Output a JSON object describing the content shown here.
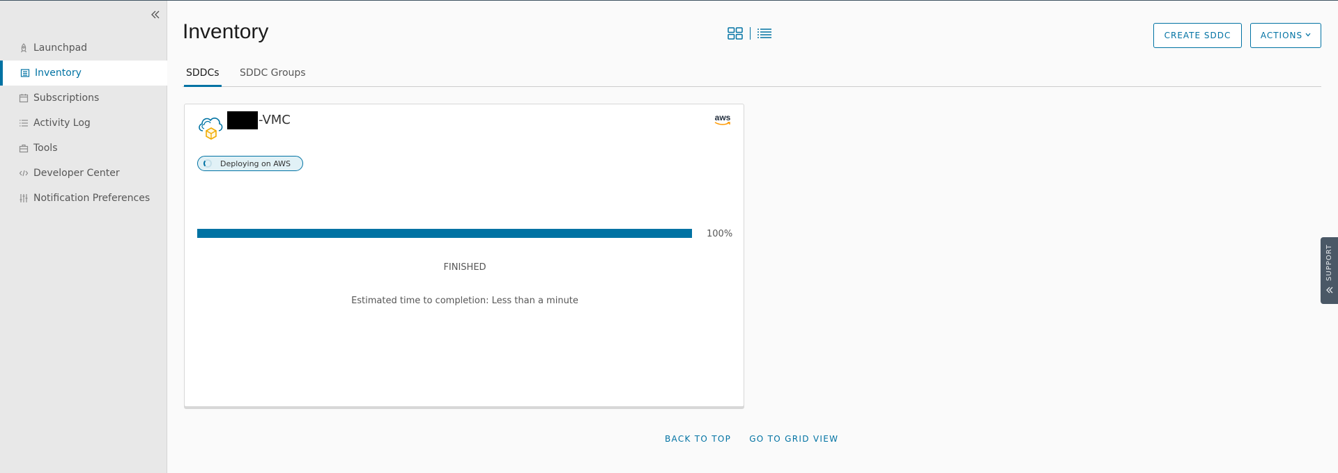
{
  "sidebar": {
    "collapse_icon": "double-chevron-left-icon",
    "items": [
      {
        "label": "Launchpad",
        "icon": "rocket-icon",
        "active": false
      },
      {
        "label": "Inventory",
        "icon": "inventory-icon",
        "active": true
      },
      {
        "label": "Subscriptions",
        "icon": "calendar-icon",
        "active": false
      },
      {
        "label": "Activity Log",
        "icon": "list-icon",
        "active": false
      },
      {
        "label": "Tools",
        "icon": "toolbox-icon",
        "active": false
      },
      {
        "label": "Developer Center",
        "icon": "code-icon",
        "active": false
      },
      {
        "label": "Notification Preferences",
        "icon": "sliders-icon",
        "active": false
      }
    ]
  },
  "header": {
    "title": "Inventory",
    "view_icons": [
      "grid-view-icon",
      "list-view-icon"
    ],
    "create_label": "CREATE SDDC",
    "actions_label": "ACTIONS"
  },
  "tabs": [
    {
      "label": "SDDCs",
      "active": true
    },
    {
      "label": "SDDC Groups",
      "active": false
    }
  ],
  "card": {
    "name_suffix": "-VMC",
    "provider_logo": "aws",
    "status_badge": "Deploying on AWS",
    "progress_percent": 100,
    "progress_label": "100%",
    "status": "FINISHED",
    "eta": "Estimated time to completion: Less than a minute"
  },
  "footer": {
    "back_to_top": "BACK TO TOP",
    "grid_view": "GO TO GRID VIEW"
  },
  "support": {
    "label": "SUPPORT"
  },
  "colors": {
    "accent": "#0072a3",
    "sidebar_bg": "#e8e8e8",
    "support_bg": "#4a5866"
  }
}
